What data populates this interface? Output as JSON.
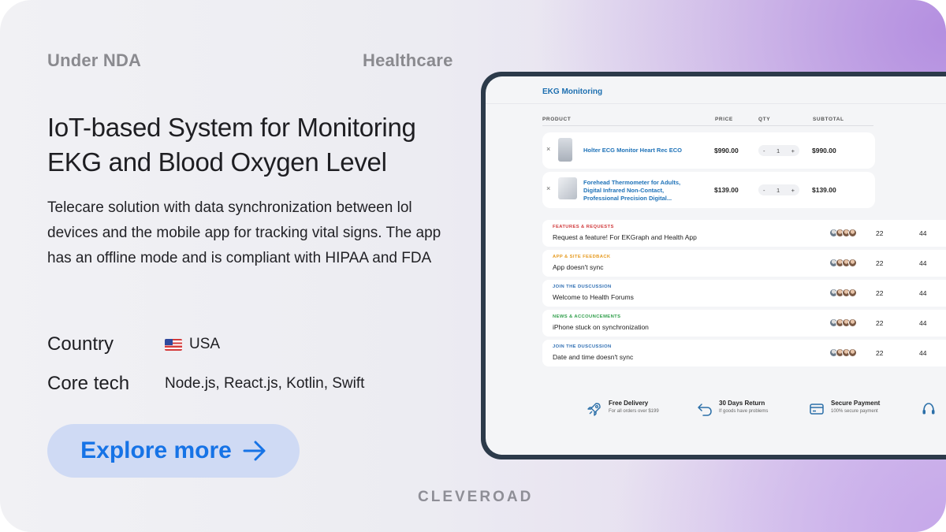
{
  "meta": {
    "nda": "Under NDA",
    "industry": "Healthcare"
  },
  "title": "IoT-based System for Monitoring EKG and Blood Oxygen Level",
  "description": "Telecare solution with data synchronization between lol devices and the mobile app for tracking vital signs. The app has an offline mode and is compliant with HIPAA and FDA",
  "country": {
    "label": "Country",
    "value": "USA",
    "flag_icon": "us-flag-icon"
  },
  "core_tech": {
    "label": "Core tech",
    "value": "Node.js, React.js, Kotlin, Swift"
  },
  "cta": {
    "label": "Explore more",
    "icon": "arrow-right-icon",
    "color": "#1673e6"
  },
  "brand": "CLEVEROAD",
  "app": {
    "title": "EKG Monitoring",
    "columns": {
      "product": "PRODUCT",
      "price": "PRICE",
      "qty": "QTY",
      "subtotal": "SUBTOTAL"
    },
    "products": [
      {
        "remove": "×",
        "name": "Holter ECG Monitor Heart Rec ECO",
        "price": "$990.00",
        "minus": "-",
        "qty": "1",
        "plus": "+",
        "subtotal": "$990.00"
      },
      {
        "remove": "×",
        "name": "Forehead Thermometer for Adults, Digital Infrared Non-Contact, Professional Precision Digital...",
        "price": "$139.00",
        "minus": "-",
        "qty": "1",
        "plus": "+",
        "subtotal": "$139.00"
      }
    ],
    "topics": [
      {
        "category": "FEATURES & REQUESTS",
        "color": "#d0393b",
        "title": "Request a feature! For EKGraph and Health App",
        "replies": "22",
        "views": "44"
      },
      {
        "category": "APP & SITE FEEDBACK",
        "color": "#e69a1f",
        "title": "App doesn't sync",
        "replies": "22",
        "views": "44"
      },
      {
        "category": "JOIN THE DUSCUSSION",
        "color": "#2f6fb3",
        "title": "Welcome to Health Forums",
        "replies": "22",
        "views": "44"
      },
      {
        "category": "NEWS & ACCOUNCEMENTS",
        "color": "#2f9e4a",
        "title": "iPhone stuck on synchronization",
        "replies": "22",
        "views": "44"
      },
      {
        "category": "JOIN THE DUSCUSSION",
        "color": "#2f6fb3",
        "title": "Date and time doesn't sync",
        "replies": "22",
        "views": "44"
      }
    ],
    "features": [
      {
        "icon": "rocket-icon",
        "title": "Free Delivery",
        "subtitle": "For all orders over $199"
      },
      {
        "icon": "return-arrow-icon",
        "title": "30 Days Return",
        "subtitle": "If goods have problems"
      },
      {
        "icon": "credit-card-icon",
        "title": "Secure Payment",
        "subtitle": "100% secure payment"
      }
    ]
  }
}
